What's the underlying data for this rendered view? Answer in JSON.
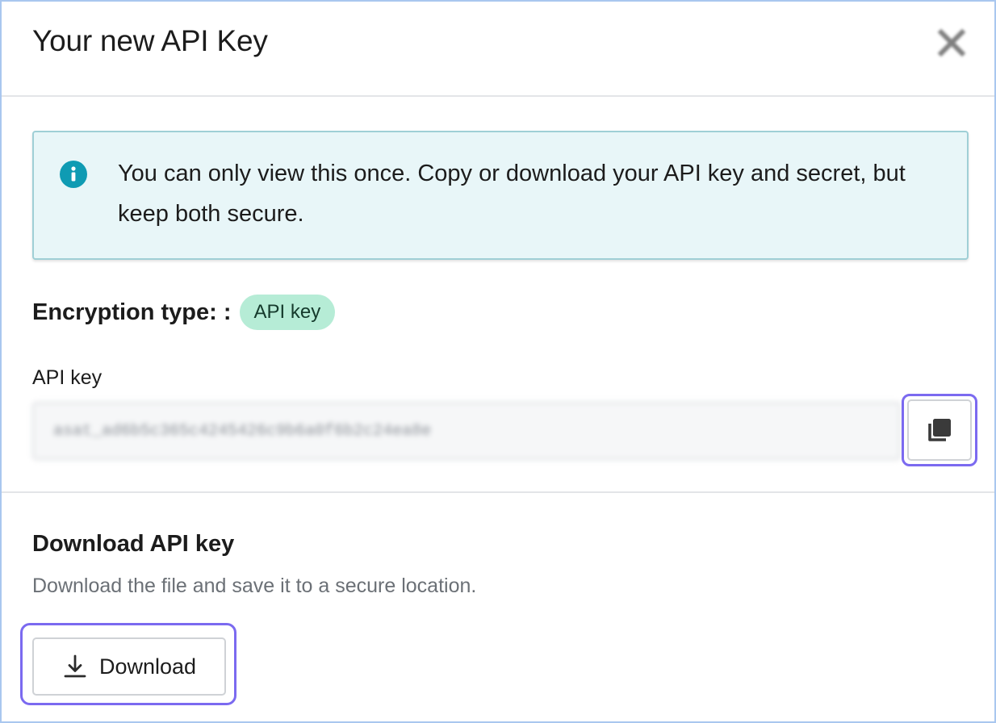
{
  "modal": {
    "title": "Your new API Key"
  },
  "notice": {
    "text": "You can only view this once. Copy or download your API key and secret, but keep both secure."
  },
  "encryption": {
    "label": "Encryption type: :",
    "badge": "API key"
  },
  "api_key_field": {
    "label": "API key",
    "value": "asat_ad6b5c365c4245426c9b6a0f6b2c24ea8e"
  },
  "download": {
    "heading": "Download API key",
    "description": "Download the file and save it to a secure location.",
    "button_label": "Download"
  },
  "colors": {
    "accent_focus": "#7b6af0",
    "info_icon": "#0f9bb3",
    "info_bg": "#e8f6f8",
    "badge_bg": "#b6ecd6"
  },
  "icons": {
    "close": "close-icon",
    "info": "info-icon",
    "copy": "copy-icon",
    "download": "download-icon"
  }
}
